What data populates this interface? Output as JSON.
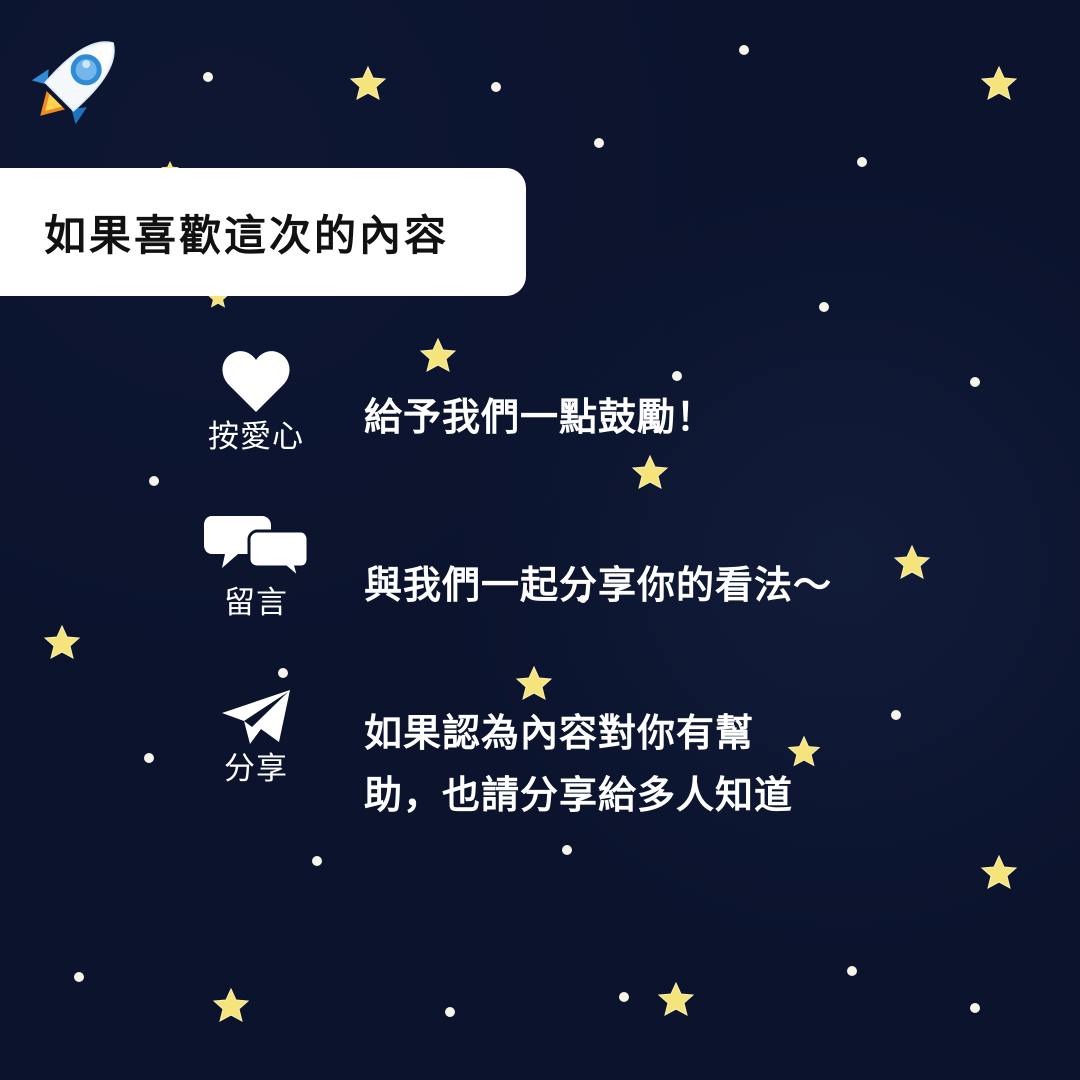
{
  "title": "如果喜歡這次的內容",
  "actions": [
    {
      "label": "按愛心",
      "text": "給予我們一點鼓勵！",
      "icon": "heart-icon"
    },
    {
      "label": "留言",
      "text": "與我們一起分享你的看法～",
      "icon": "speech-bubbles-icon"
    },
    {
      "label": "分享",
      "text": "如果認為內容對你有幫\n助，也請分享給多人知道",
      "icon": "paper-plane-icon"
    }
  ],
  "colors": {
    "background": "#0b132d",
    "card": "#ffffff",
    "text_light": "#ffffff",
    "text_dark": "#111111",
    "star": "#f7e27a"
  }
}
